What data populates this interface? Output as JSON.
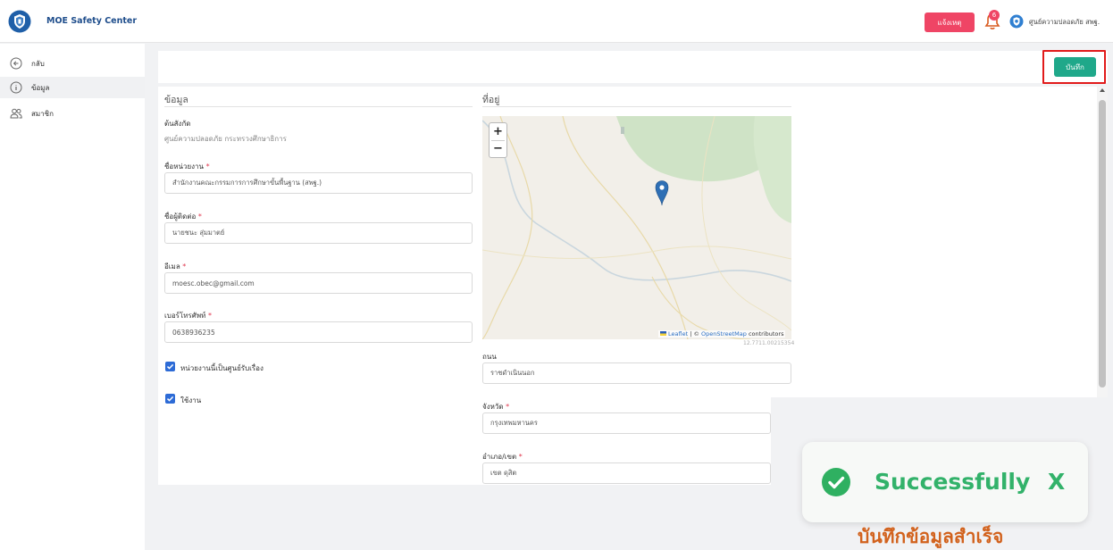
{
  "header": {
    "app_title": "MOE Safety Center",
    "report_button": "แจ้งเหตุ",
    "notification_count": "6",
    "org_name": "ศูนย์ความปลอดภัย สพฐ."
  },
  "sidebar": {
    "items": [
      {
        "label": "กลับ",
        "icon": "arrow-left-circle-icon"
      },
      {
        "label": "ข้อมูล",
        "icon": "info-circle-icon"
      },
      {
        "label": "สมาชิก",
        "icon": "users-icon"
      }
    ]
  },
  "toolbar": {
    "save_label": "บันทึก"
  },
  "info": {
    "title": "ข้อมูล",
    "affiliation_label": "ต้นสังกัด",
    "affiliation_value": "ศูนย์ความปลอดภัย กระทรวงศึกษาธิการ",
    "unit_label": "ชื่อหน่วยงาน",
    "unit_value": "สำนักงานคณะกรรมการการศึกษาขั้นพื้นฐาน (สพฐ.)",
    "contact_label": "ชื่อผู้ติดต่อ",
    "contact_value": "นายชนะ สุ่มมาตย์",
    "email_label": "อีเมล",
    "email_value": "moesc.obec@gmail.com",
    "phone_label": "เบอร์โทรศัพท์",
    "phone_value": "0638936235",
    "check_center_label": "หน่วยงานนี้เป็นศูนย์รับเรื่อง",
    "check_active_label": "ใช้งาน",
    "required_mark": "*"
  },
  "address": {
    "title": "ที่อยู่",
    "map_attribution_leaflet": "Leaflet",
    "map_attribution_sep": " | © ",
    "map_attribution_osm": "OpenStreetMap",
    "map_attribution_tail": " contributors",
    "map_coords": "12.7711.00215354",
    "road_label": "ถนน",
    "road_value": "ราชดำเนินนอก",
    "province_label": "จังหวัด",
    "province_value": "กรุงเทพมหานคร",
    "district_label": "อำเภอ/เขต",
    "district_value": "เขต ดุสิต",
    "zoom_in": "+",
    "zoom_out": "−"
  },
  "toast": {
    "message": "Successfully",
    "close": "X",
    "caption": "บันทึกข้อมูลสำเร็จ"
  },
  "colors": {
    "accent_green": "#1fa88a",
    "report_red": "#ef4565",
    "success_green": "#32b26a",
    "caption_orange": "#d2621d",
    "checkbox_blue": "#2d6bd6"
  }
}
